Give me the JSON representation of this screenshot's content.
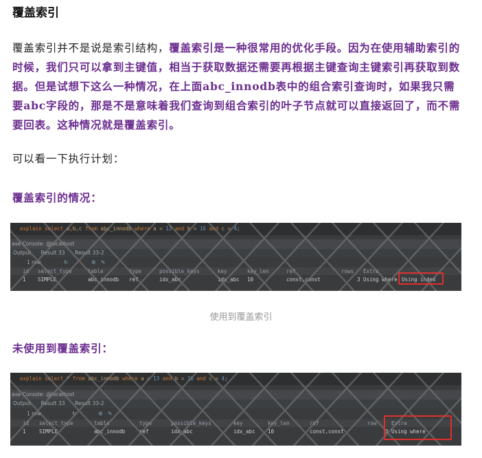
{
  "heading": "覆盖索引",
  "paragraph": {
    "p1": "覆盖索引并不是说是索引结构，",
    "p2": "覆盖索引是一种很常用的优化手段。因为在使用辅助索引的时候，我们只可以拿到主键值，相当于获取数据还需要再根据主键查询主键索引再获取到数据。但是试想下这么一种情况，在上面abc_innodb表中的组合索引查询时，如果我只需要abc字段的，那是不是意味着我们查询到组合索引的叶子节点就可以直接返回了，而不需要回表。这种情况就是覆盖索引。"
  },
  "plan_text": "可以看一下执行计划：",
  "section1_title": "覆盖索引的情况：",
  "caption1": "使用到覆盖索引",
  "section2_title": "未使用到覆盖索引：",
  "shot1": {
    "sql": {
      "kw1": "explain select",
      "cols": " a,b,c ",
      "kw2": "from",
      "table": " abc_innodb ",
      "kw3": "where",
      "c1": " a = ",
      "v1": "13",
      "and1": " and ",
      "c2": "b = ",
      "v2": "16",
      "and2": " and ",
      "c3": "c = ",
      "v3": "4",
      "end": ";"
    },
    "console": "ase Console:   @localhost",
    "tabs": [
      "Output",
      "Result 33",
      "Result 33-2"
    ],
    "rows_label": "1 row",
    "headers": [
      "id",
      "select_type",
      "table",
      "type",
      "possible_keys",
      "key",
      "key_len",
      "ref",
      "rows",
      "Extra"
    ],
    "row": [
      "1",
      "SIMPLE",
      "abc_innodb",
      "ref",
      "idx_abc",
      "idx_abc",
      "10",
      "const,const",
      "3",
      "Using where;",
      "Using index"
    ]
  },
  "shot2": {
    "sql": {
      "kw1": "explain select",
      "cols": " * ",
      "kw2": "from",
      "table": " abc_innodb ",
      "kw3": "where",
      "c1": " a = ",
      "v1": "13",
      "and1": " and ",
      "c2": "b = ",
      "v2": "16",
      "and2": " and ",
      "c3": "c = ",
      "v3": "4",
      "end": ";"
    },
    "console": "ase Console:   @localhost",
    "tabs": [
      "Output",
      "Result 33",
      "Result 33-2"
    ],
    "rows_label": "1 row",
    "headers": [
      "id",
      "select_type",
      "table",
      "type",
      "possible_keys",
      "key",
      "key_len",
      "ref",
      "row",
      "Extra"
    ],
    "row": [
      "1",
      "SIMPLE",
      "abc_innodb",
      "ref",
      "idx_abc",
      "idx_abc",
      "10",
      "const,const",
      "3",
      "Using where"
    ]
  }
}
